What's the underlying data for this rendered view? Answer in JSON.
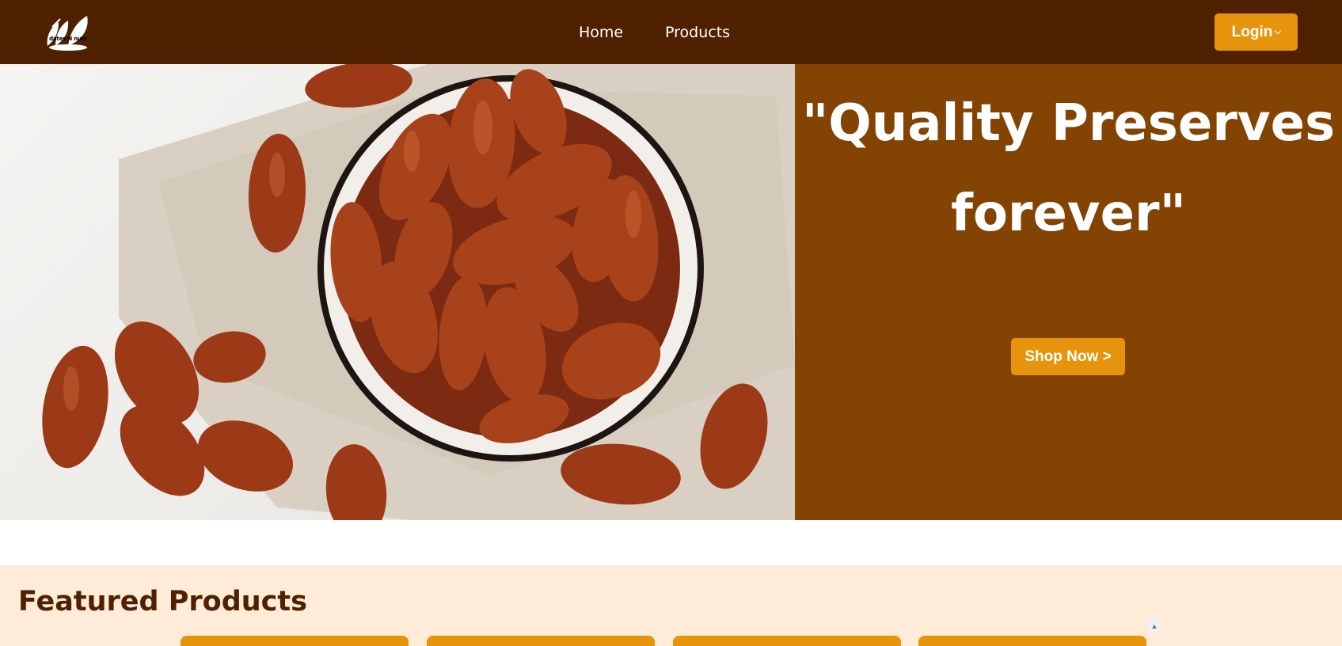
{
  "header": {
    "logo_text": "dates N nuts",
    "nav": [
      "Home",
      "Products"
    ],
    "login_label": "Login"
  },
  "hero": {
    "quote_line1": "\"Quality Preserves",
    "quote_line2": "forever\"",
    "cta_label": "Shop Now >"
  },
  "featured": {
    "title": "Featured Products"
  },
  "colors": {
    "header_bg": "#4f2100",
    "hero_panel_bg": "#834302",
    "accent": "#e5940b",
    "featured_bg": "#feebd8"
  }
}
